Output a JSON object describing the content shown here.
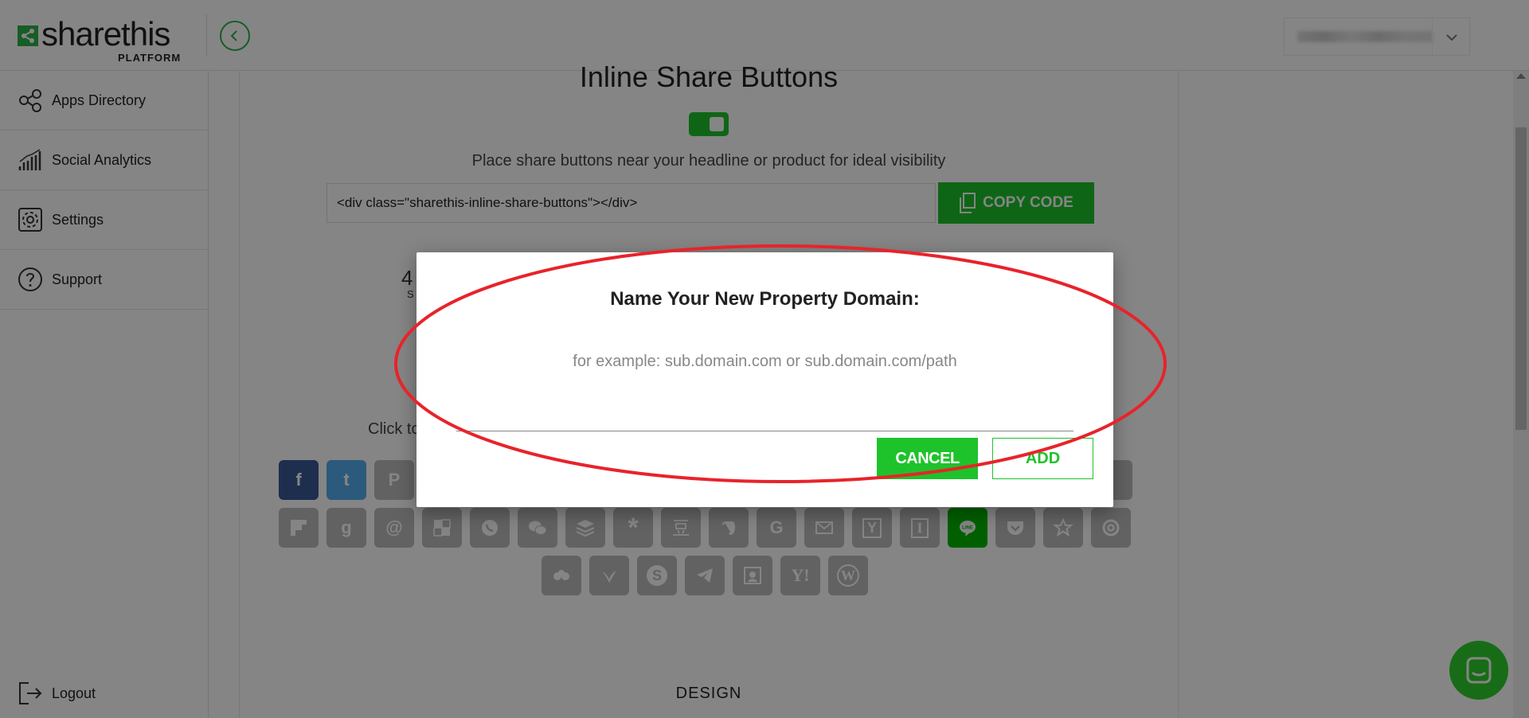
{
  "header": {
    "logo_word": "sharethis",
    "logo_sub": "PLATFORM",
    "back_icon": "chevron-left-circle-icon",
    "account_icon": "chevron-down-icon"
  },
  "sidebar": {
    "items": [
      {
        "label": "Apps Directory",
        "icon": "share-nodes-icon"
      },
      {
        "label": "Social Analytics",
        "icon": "bar-chart-icon"
      },
      {
        "label": "Settings",
        "icon": "gear-icon"
      },
      {
        "label": "Support",
        "icon": "question-circle-icon"
      }
    ],
    "logout_label": "Logout"
  },
  "main": {
    "title": "Inline Share Buttons",
    "toggle_on": true,
    "description": "Place share buttons near your headline or product for ideal visibility",
    "code_snippet": "<div class=\"sharethis-inline-share-buttons\"></div>",
    "copy_button": "COPY CODE",
    "stat_number": "4",
    "stat_label": "S",
    "click_to_text": "Click to",
    "design_label": "DESIGN",
    "networks_row1": [
      "f",
      "t",
      "P"
    ],
    "networks_row2": [
      "flipboard",
      "goodreads",
      "@",
      "delicious",
      "viber",
      "wechat",
      "buffer",
      "*",
      "douban",
      "evernote",
      "G",
      "gmail",
      "Y",
      "I",
      "line",
      "pocket",
      "star",
      "@"
    ],
    "networks_row3": [
      "meetup",
      "bird",
      "S",
      "telegram",
      "tumblr",
      "Y!",
      "W"
    ]
  },
  "modal": {
    "title": "Name Your New Property Domain:",
    "input_placeholder": "for example: sub.domain.com or sub.domain.com/path",
    "input_value": "",
    "cancel_label": "CANCEL",
    "add_label": "ADD"
  },
  "colors": {
    "accent_green": "#1ec22b",
    "facebook": "#3b5998",
    "twitter": "#55acee",
    "line": "#00b900",
    "highlight_red": "#e8232a",
    "overlay": "rgba(0,0,0,0.48)"
  }
}
